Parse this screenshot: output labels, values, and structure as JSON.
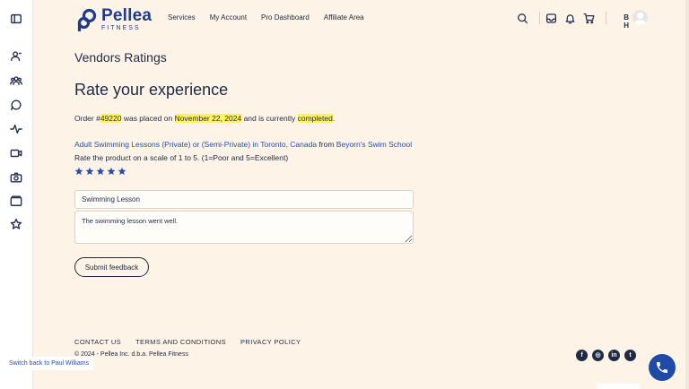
{
  "brand": {
    "name": "Pellea",
    "sub": "FITNESS"
  },
  "nav": [
    {
      "label": "Services"
    },
    {
      "label": "My Account"
    },
    {
      "label": "Pro Dashboard"
    },
    {
      "label": "Affiliate Area"
    }
  ],
  "user": {
    "initials": "B H"
  },
  "page": {
    "vendors_title": "Vendors Ratings",
    "rate_title": "Rate your experience",
    "order": {
      "prefix": "Order #",
      "number": "49220",
      "mid1": " was placed on ",
      "date": "November 22, 2024",
      "mid2": " and is currently ",
      "status": "completed",
      "suffix": "."
    },
    "product": {
      "name": "Adult Swimming Lessons (Private) or (Semi-Private) in Toronto, Canada",
      "from": " from ",
      "vendor": "Beyorn's Swim School"
    },
    "scale_text": "Rate the product on a scale of 1 to 5. (1=Poor and 5=Excellent)",
    "rating": 5,
    "review_title": "Swimming Lesson",
    "review_text": "The swimming lesson went well.",
    "submit_label": "Submit feedback"
  },
  "footer": {
    "links": [
      {
        "label": "CONTACT US"
      },
      {
        "label": "TERMS AND CONDITIONS"
      },
      {
        "label": "PRIVACY POLICY"
      }
    ],
    "copyright": "© 2024 - Pellea Inc. d.b.a. Pellea Fitness",
    "socials": [
      "facebook-icon",
      "instagram-icon",
      "linkedin-icon",
      "twitter-icon"
    ]
  },
  "switch_back": "Switch back to Paul Williams",
  "colors": {
    "accent": "#1f4aa8",
    "highlight": "#fff35c",
    "background": "#fdf3e6",
    "text": "#1f2a44"
  }
}
